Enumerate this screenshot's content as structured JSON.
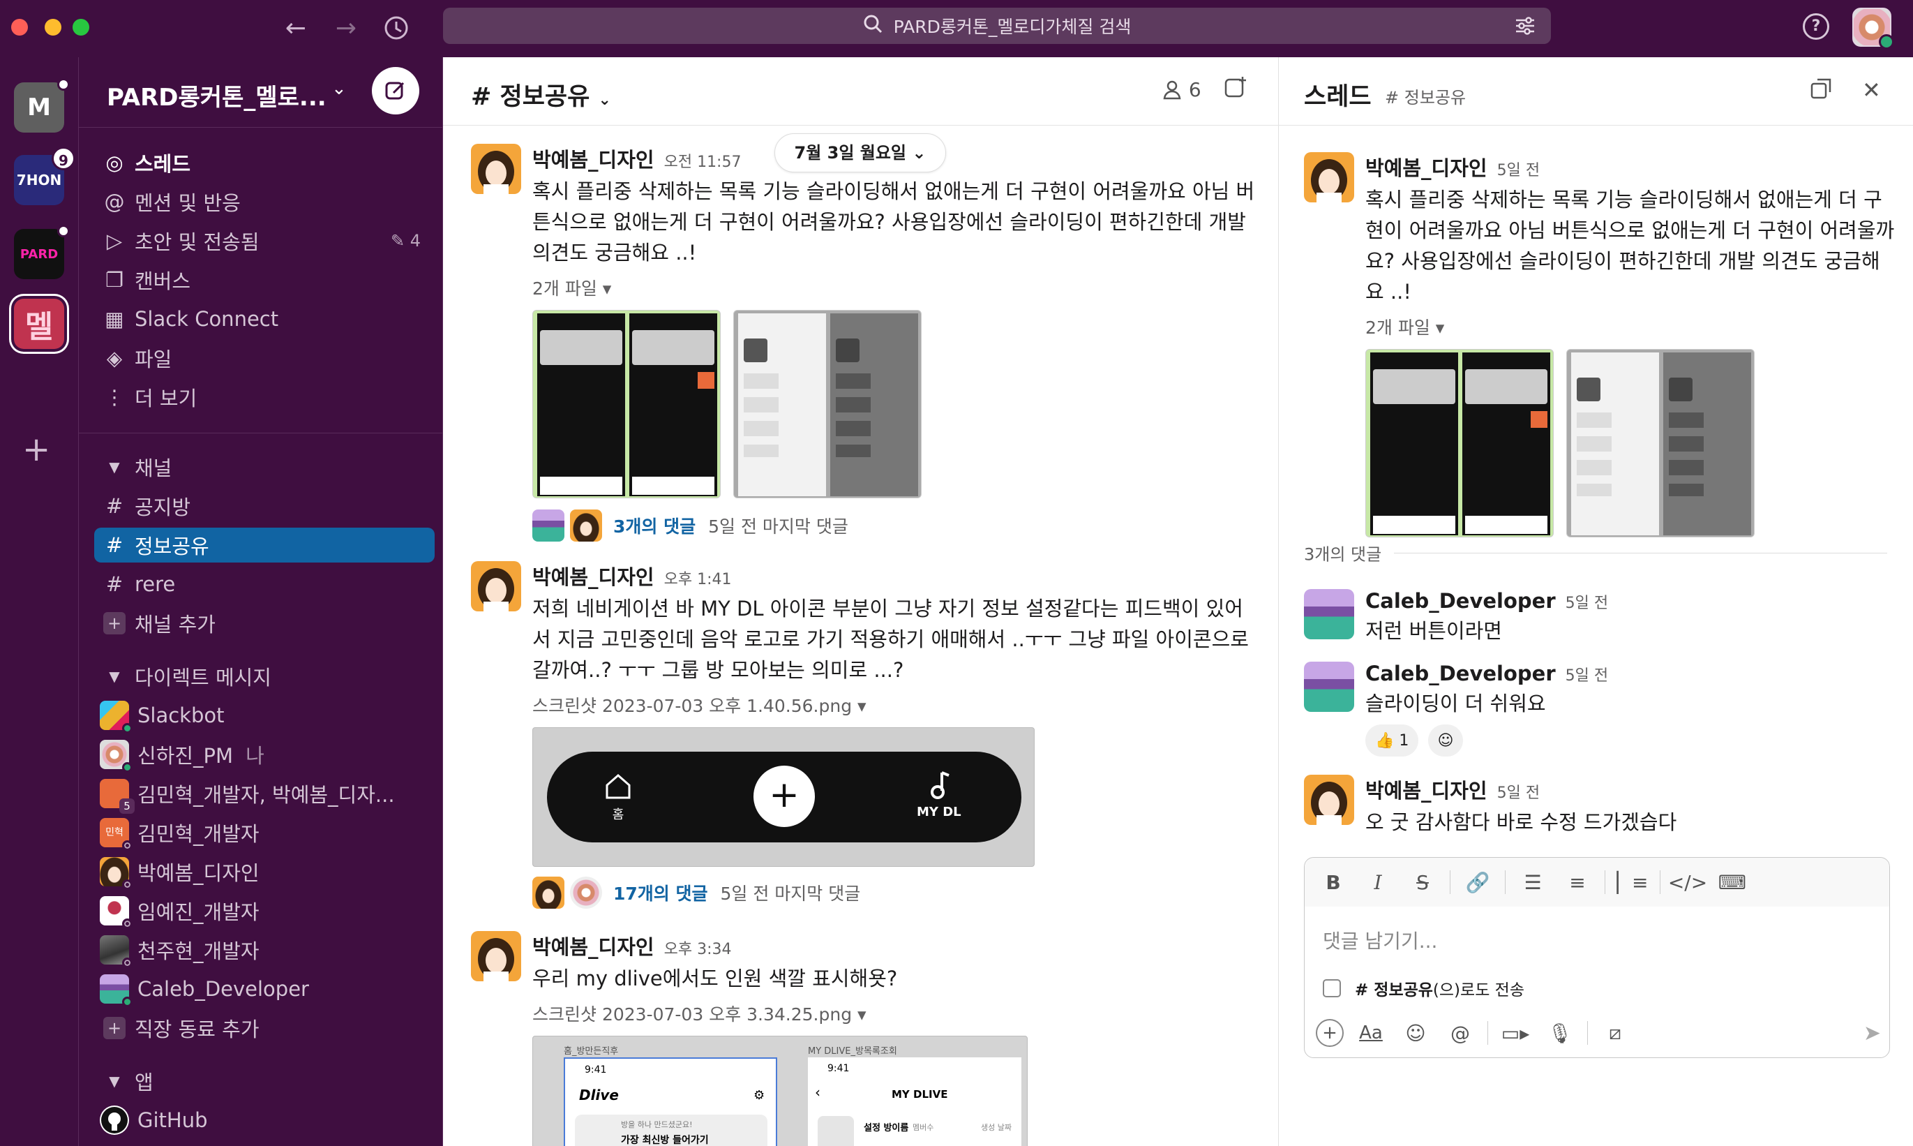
{
  "app": {
    "search_text": "PARD롱커톤_멜로디가체질 검색"
  },
  "rail": {
    "workspaces": [
      {
        "label": "M"
      },
      {
        "label": "7HON",
        "badge": "9"
      },
      {
        "label": "PARD"
      },
      {
        "label": "멜"
      }
    ]
  },
  "sidebar": {
    "workspace_name": "PARD롱커톤_멜로...",
    "nav": [
      {
        "label": "스레드"
      },
      {
        "label": "멘션 및 반응"
      },
      {
        "label": "초안 및 전송됨",
        "count": "4"
      },
      {
        "label": "캔버스"
      },
      {
        "label": "Slack Connect"
      },
      {
        "label": "파일"
      },
      {
        "label": "더 보기"
      }
    ],
    "channels_header": "채널",
    "channels": [
      {
        "label": "공지방"
      },
      {
        "label": "정보공유"
      },
      {
        "label": "rere"
      }
    ],
    "add_channel": "채널 추가",
    "dm_header": "다이렉트 메시지",
    "dms": [
      {
        "label": "Slackbot"
      },
      {
        "label": "신하진_PM",
        "tag": "나"
      },
      {
        "label": "김민혁_개발자, 박예봄_디자...",
        "count": "5"
      },
      {
        "label": "김민혁_개발자"
      },
      {
        "label": "박예봄_디자인"
      },
      {
        "label": "임예진_개발자"
      },
      {
        "label": "천주현_개발자"
      },
      {
        "label": "Caleb_Developer"
      }
    ],
    "add_coworker": "직장 동료 추가",
    "apps_header": "앱",
    "apps": [
      {
        "label": "GitHub"
      }
    ]
  },
  "channel": {
    "title": "정보공유",
    "member_count": "6",
    "date_pill": "7월 3일 월요일"
  },
  "messages": [
    {
      "user": "박예봄_디자인",
      "time": "오전 11:57",
      "text": "혹시 플리중 삭제하는 목록 기능 슬라이딩해서 없애는게 더 구현이 어려울까요 아님 버튼식으로 없애는게 더 구현이 어려울까요? 사용입장에선 슬라이딩이 편하긴한데 개발 의견도 궁금해요 ..!",
      "file_info": "2개 파일",
      "replies": "3개의 댓글",
      "last_reply": "5일 전 마지막 댓글"
    },
    {
      "user": "박예봄_디자인",
      "time": "오후 1:41",
      "text": "저희 네비게이션 바 MY DL 아이콘 부분이 그냥 자기 정보 설정같다는 피드백이 있어서 지금 고민중인데 음악 로고로 가기 적용하기 애매해서 ..ㅜㅜ 그냥 파일 아이콘으로 갈까여..? ㅜㅜ 그룹 방 모아보는 의미로 ...?",
      "file_info": "스크린샷 2023-07-03 오후 1.40.56.png",
      "nav_home": "홈",
      "nav_mydl": "MY DL",
      "replies": "17개의 댓글",
      "last_reply": "5일 전 마지막 댓글"
    },
    {
      "user": "박예봄_디자인",
      "time": "오후 3:34",
      "text": "우리 my dlive에서도 인원 색깔 표시해욧?",
      "file_info": "스크린샷 2023-07-03 오후 3.34.25.png",
      "shot": {
        "left_label": "홈_방만든직후",
        "right_label": "MY DLIVE_방목록조회",
        "time": "9:41",
        "brand": "Dlive",
        "card_sub": "방을 하나 만드셨군요!",
        "card_title": "가장 최신방 들어가기",
        "mydlive": "MY DLIVE",
        "setting_name": "설정 방이름",
        "member": "멤버수",
        "date": "생성 날짜"
      }
    }
  ],
  "thread": {
    "title": "스레드",
    "channel": "# 정보공유",
    "root": {
      "user": "박예봄_디자인",
      "time": "5일 전",
      "text": "혹시 플리중 삭제하는 목록 기능 슬라이딩해서 없애는게 더 구현이 어려울까요 아님 버튼식으로 없애는게 더 구현이 어려울까요? 사용입장에선 슬라이딩이 편하긴한데 개발 의견도 궁금해요 ..!",
      "file_info": "2개 파일"
    },
    "reply_count": "3개의 댓글",
    "replies": [
      {
        "user": "Caleb_Developer",
        "time": "5일 전",
        "text": "저런 버튼이라면"
      },
      {
        "user": "Caleb_Developer",
        "time": "5일 전",
        "text": "슬라이딩이 더 쉬워요",
        "reaction": "1"
      },
      {
        "user": "박예봄_디자인",
        "time": "5일 전",
        "text": "오 굿 감사함다 바로 수정 드가겠습다"
      }
    ],
    "composer": {
      "placeholder": "댓글 남기기...",
      "also_send_channel": "# 정보공유",
      "also_send_suffix": "(으)로도 전송"
    }
  }
}
